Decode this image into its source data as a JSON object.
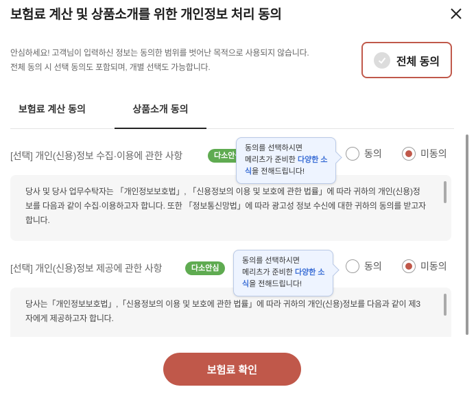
{
  "dialog": {
    "title": "보험료 계산 및 상품소개를 위한 개인정보 처리 동의",
    "close_icon": "close-icon"
  },
  "intro": {
    "line1": "안심하세요! 고객님이 입력하신 정보는 동의한 범위를 벗어난 목적으로 사용되지 않습니다.",
    "line2": "전체 동의 시 선택 동의도 포함되며, 개별 선택도 가능합니다."
  },
  "all_agree": {
    "label": "전체 동의",
    "icon": "check-circle-icon",
    "checked": false
  },
  "tabs": [
    {
      "label": "보험료 계산 동의",
      "active": false
    },
    {
      "label": "상품소개 동의",
      "active": true
    }
  ],
  "sections": [
    {
      "title": "[선택] 개인(신용)정보 수집·이용에 관한 사항",
      "badge": "다소안심",
      "agree_label": "동의",
      "disagree_label": "미동의",
      "selected": "disagree",
      "body": "당사 및 당사 업무수탁자는 「개인정보보호법」, 「신용정보의 이용 및 보호에 관한 법률」에 따라 귀하의 개인(신용)정보를 다음과 같이 수집·이용하고자 합니다. 또한 「정보통신망법」에 따라 광고성 정보 수신에 대한 귀하의 동의를 받고자 합니다.",
      "tooltip": {
        "line1": "동의를 선택하시면",
        "line2_pre": "메리츠가 준비한 ",
        "highlight": "다양한 소식",
        "line3_post": "을 전해드립니다!"
      }
    },
    {
      "title": "[선택] 개인(신용)정보 제공에 관한 사항",
      "badge": "다소안심",
      "agree_label": "동의",
      "disagree_label": "미동의",
      "selected": "disagree",
      "body": "당사는「개인정보보호법」,「신용정보의 이용 및 보호에 관한 법률」에 따라 귀하의 개인(신용)정보를 다음과 같이 제3자에게 제공하고자 합니다.",
      "tooltip": {
        "line1": "동의를 선택하시면",
        "line2_pre": "메리츠가 준비한 ",
        "highlight": "다양한 소식",
        "line3_post": "을 전해드립니다!"
      }
    }
  ],
  "confirm_button": {
    "label": "보험료 확인"
  },
  "colors": {
    "accent": "#c0584a",
    "badge_green": "#5fab51",
    "tooltip_highlight": "#3c6fd6"
  }
}
